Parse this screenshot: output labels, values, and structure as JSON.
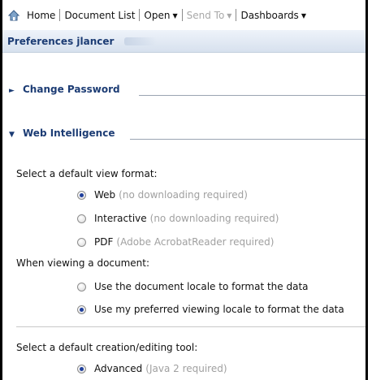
{
  "toolbar": {
    "home": "Home",
    "document_list": "Document List",
    "open": "Open",
    "send_to": "Send To",
    "dashboards": "Dashboards"
  },
  "tab": {
    "title": "Preferences",
    "user": "jlancer"
  },
  "sections": {
    "change_password": "Change Password",
    "web_intelligence": "Web Intelligence"
  },
  "view_format": {
    "label": "Select a default view format:",
    "options": [
      {
        "name": "Web",
        "hint": "(no downloading required)",
        "checked": true
      },
      {
        "name": "Interactive",
        "hint": "(no downloading required)",
        "checked": false
      },
      {
        "name": "PDF",
        "hint": "(Adobe AcrobatReader required)",
        "checked": false
      }
    ]
  },
  "viewing": {
    "label": "When viewing a document:",
    "options": [
      {
        "name": "Use the document locale to format the data",
        "checked": false
      },
      {
        "name": "Use my preferred viewing locale to format the data",
        "checked": true
      }
    ]
  },
  "creation": {
    "label": "Select a default creation/editing tool:",
    "options": [
      {
        "name": "Advanced",
        "hint": "(Java 2 required)",
        "checked": true
      }
    ]
  },
  "colors": {
    "section_blue": "#1c3c74",
    "hint_gray": "#a0a0a0"
  }
}
